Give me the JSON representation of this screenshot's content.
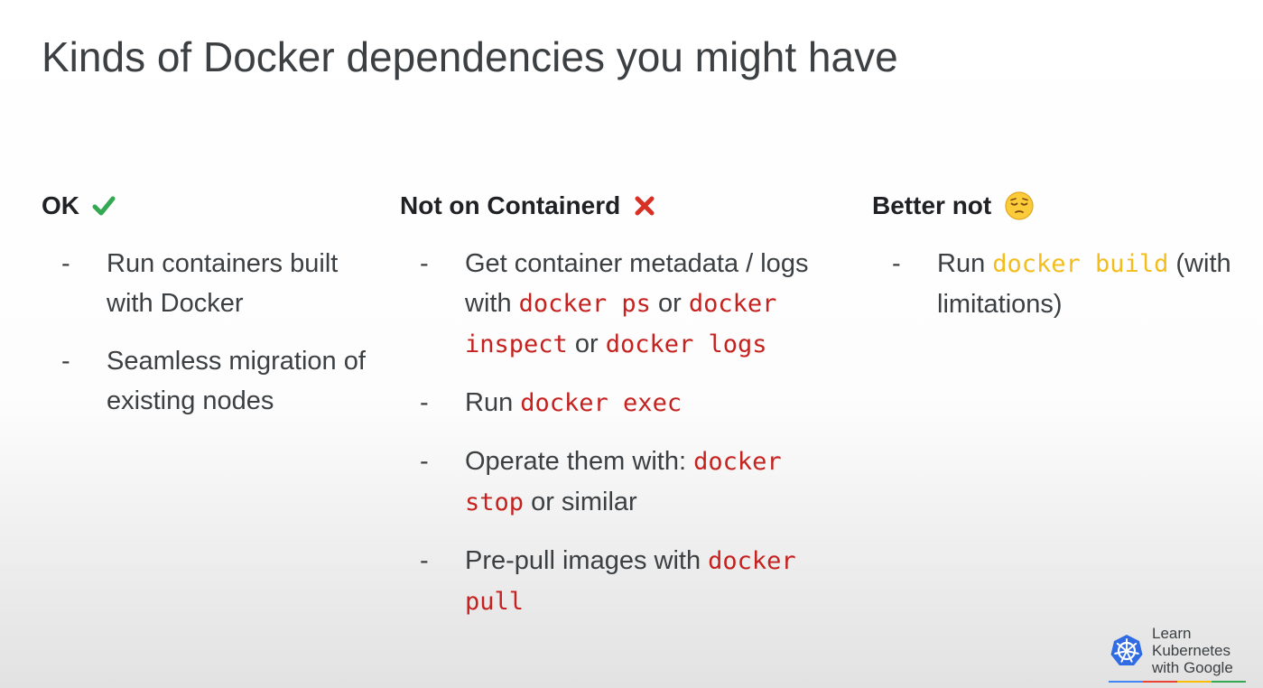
{
  "slide": {
    "title": "Kinds of Docker dependencies you might have"
  },
  "columns": {
    "ok": {
      "heading": "OK",
      "icon": "check-mark-icon",
      "items": [
        {
          "text": "Run containers built with Docker"
        },
        {
          "text": "Seamless migration of existing nodes"
        }
      ]
    },
    "not_containerd": {
      "heading": "Not on Containerd",
      "icon": "cross-mark-icon",
      "items": [
        {
          "t1": "Get container metadata / logs with ",
          "c1": "docker ps",
          "t2": " or ",
          "c2": "docker inspect",
          "t3": " or ",
          "c3": "docker logs"
        },
        {
          "t1": "Run ",
          "c1": "docker exec"
        },
        {
          "t1": "Operate them with: ",
          "c1": "docker stop",
          "t2": " or similar"
        },
        {
          "t1": "Pre-pull images with ",
          "c1": "docker pull"
        }
      ]
    },
    "better_not": {
      "heading": "Better not",
      "icon": "pensive-face-icon",
      "items": [
        {
          "t1": "Run ",
          "c1": "docker build",
          "t2": " (with limitations)"
        }
      ]
    }
  },
  "dash": "-",
  "branding": {
    "logo_text": [
      "Learn",
      "Kubernetes",
      "with Google"
    ],
    "icon": "kubernetes-wheel-icon"
  },
  "colors": {
    "text": "#3c4043",
    "code_red": "#c5221f",
    "code_yellow": "#f2bd1d",
    "check_green": "#34a853",
    "cross_red": "#d93025",
    "kubernetes_blue": "#326ce5"
  }
}
